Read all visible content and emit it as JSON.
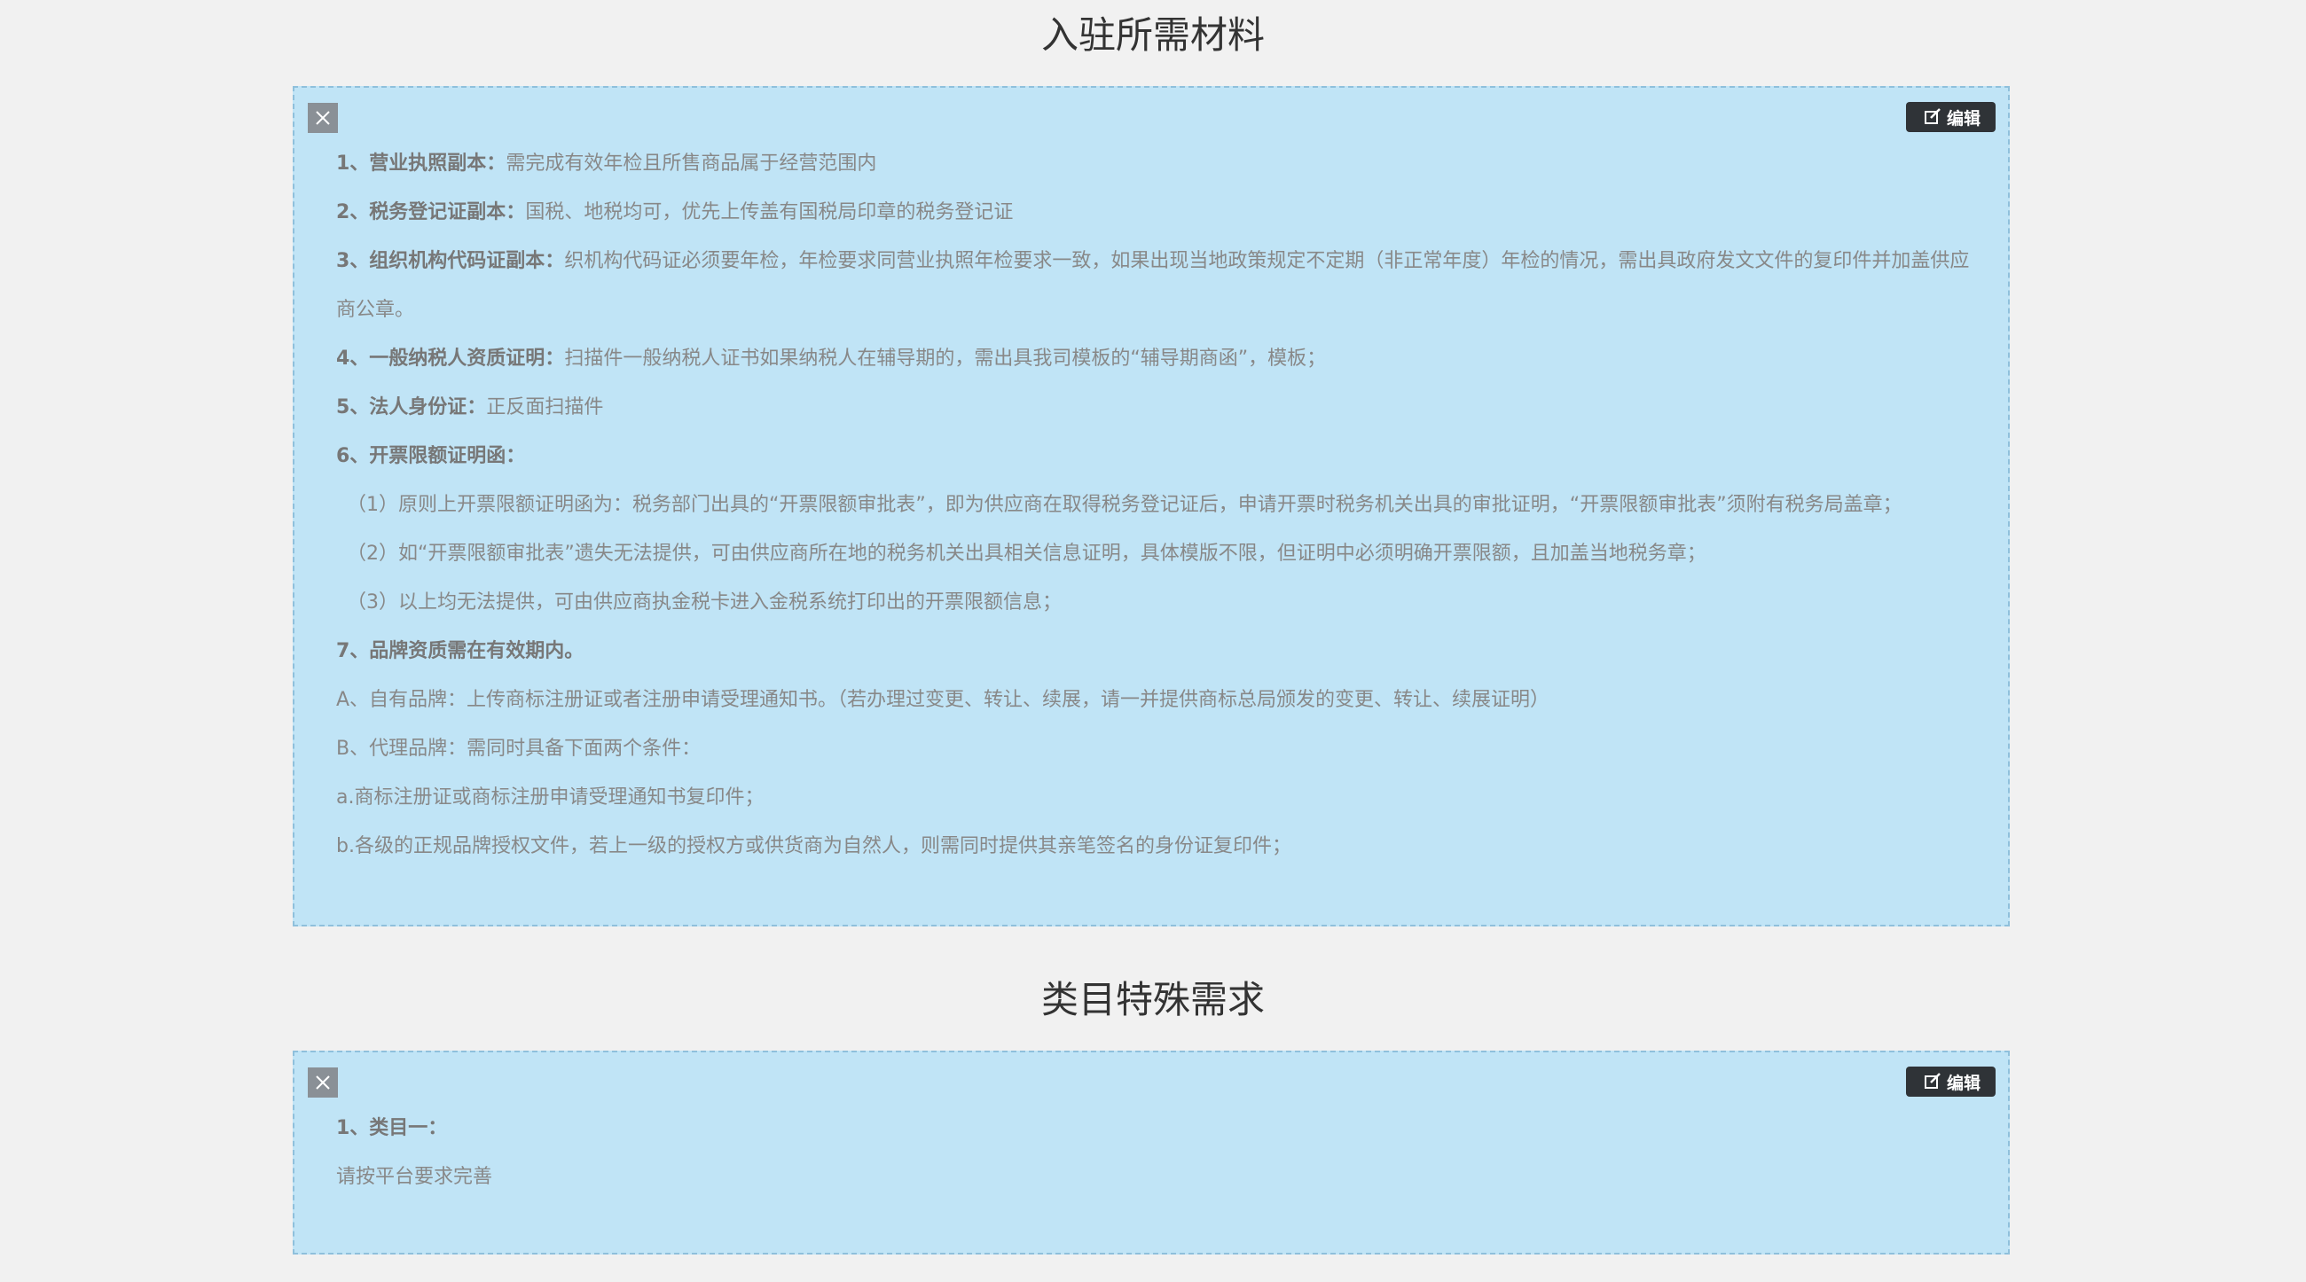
{
  "sections": [
    {
      "title": "入驻所需材料",
      "edit_label": "编辑",
      "lines": [
        {
          "head": "1、营业执照副本：",
          "text": "需完成有效年检且所售商品属于经营范围内"
        },
        {
          "head": "2、税务登记证副本：",
          "text": "国税、地税均可，优先上传盖有国税局印章的税务登记证"
        },
        {
          "head": "3、组织机构代码证副本：",
          "text": "织机构代码证必须要年检，年检要求同营业执照年检要求一致，如果出现当地政策规定不定期（非正常年度）年检的情况，需出具政府发文文件的复印件并加盖供应商公章。"
        },
        {
          "head": "4、一般纳税人资质证明：",
          "text": "扫描件一般纳税人证书如果纳税人在辅导期的，需出具我司模板的“辅导期商函”，模板；"
        },
        {
          "head": "5、法人身份证：",
          "text": "正反面扫描件"
        },
        {
          "head": "6、开票限额证明函：",
          "text": ""
        },
        {
          "head": "",
          "text": "（1）原则上开票限额证明函为：税务部门出具的“开票限额审批表”，即为供应商在取得税务登记证后，申请开票时税务机关出具的审批证明，“开票限额审批表”须附有税务局盖章；"
        },
        {
          "head": "",
          "text": "（2）如“开票限额审批表”遗失无法提供，可由供应商所在地的税务机关出具相关信息证明，具体模版不限，但证明中必须明确开票限额，且加盖当地税务章；"
        },
        {
          "head": "",
          "text": "（3）以上均无法提供，可由供应商执金税卡进入金税系统打印出的开票限额信息；"
        },
        {
          "head": "7、品牌资质需在有效期内。",
          "text": ""
        },
        {
          "head": "",
          "text": "A、自有品牌：上传商标注册证或者注册申请受理通知书。（若办理过变更、转让、续展，请一并提供商标总局颁发的变更、转让、续展证明）"
        },
        {
          "head": "",
          "text": "B、代理品牌：需同时具备下面两个条件："
        },
        {
          "head": "",
          "text": "a.商标注册证或商标注册申请受理通知书复印件；"
        },
        {
          "head": "",
          "text": "b.各级的正规品牌授权文件，若上一级的授权方或供货商为自然人，则需同时提供其亲笔签名的身份证复印件；"
        }
      ]
    },
    {
      "title": "类目特殊需求",
      "edit_label": "编辑",
      "lines": [
        {
          "head": "1、类目一：",
          "text": ""
        },
        {
          "head": "",
          "text": "请按平台要求完善"
        }
      ]
    }
  ],
  "icons": {
    "close": "close-icon",
    "edit": "edit-icon"
  },
  "colors": {
    "panel_bg": "#c0e4f6",
    "panel_border": "#8fc0dc",
    "page_bg": "#f1f1f1",
    "edit_button_bg": "#2f3337",
    "close_button_bg": "#8a9096"
  }
}
